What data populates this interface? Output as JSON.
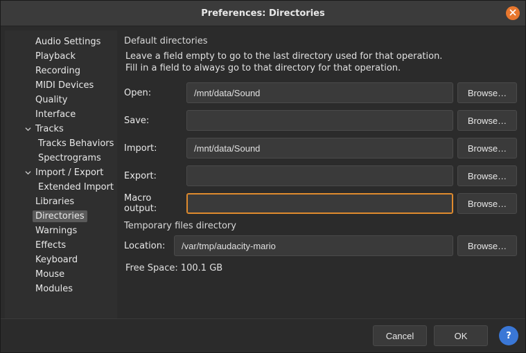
{
  "window": {
    "title": "Preferences: Directories"
  },
  "sidebar": {
    "items": [
      {
        "label": "Audio Settings",
        "level": 1
      },
      {
        "label": "Playback",
        "level": 1
      },
      {
        "label": "Recording",
        "level": 1
      },
      {
        "label": "MIDI Devices",
        "level": 1
      },
      {
        "label": "Quality",
        "level": 1
      },
      {
        "label": "Interface",
        "level": 1
      },
      {
        "label": "Tracks",
        "level": 1,
        "expanded": true
      },
      {
        "label": "Tracks Behaviors",
        "level": 2
      },
      {
        "label": "Spectrograms",
        "level": 2
      },
      {
        "label": "Import / Export",
        "level": 1,
        "expanded": true
      },
      {
        "label": "Extended Import",
        "level": 2
      },
      {
        "label": "Libraries",
        "level": 1
      },
      {
        "label": "Directories",
        "level": 1,
        "selected": true
      },
      {
        "label": "Warnings",
        "level": 1
      },
      {
        "label": "Effects",
        "level": 1
      },
      {
        "label": "Keyboard",
        "level": 1
      },
      {
        "label": "Mouse",
        "level": 1
      },
      {
        "label": "Modules",
        "level": 1
      }
    ]
  },
  "sections": {
    "default_dirs": {
      "title": "Default directories",
      "hint1": "Leave a field empty to go to the last directory used for that operation.",
      "hint2": "Fill in a field to always go to that directory for that operation.",
      "rows": [
        {
          "label": "Open:",
          "value": "/mnt/data/Sound",
          "browse": "Browse…"
        },
        {
          "label": "Save:",
          "value": "",
          "browse": "Browse…"
        },
        {
          "label": "Import:",
          "value": "/mnt/data/Sound",
          "browse": "Browse…"
        },
        {
          "label": "Export:",
          "value": "",
          "browse": "Browse…"
        },
        {
          "label": "Macro output:",
          "value": "",
          "browse": "Browse…",
          "focused": true
        }
      ]
    },
    "temp": {
      "title": "Temporary files directory",
      "label": "Location:",
      "value": "/var/tmp/audacity-mario",
      "browse": "Browse…",
      "free": "Free Space: 100.1 GB"
    }
  },
  "footer": {
    "cancel": "Cancel",
    "ok": "OK",
    "help": "?"
  }
}
